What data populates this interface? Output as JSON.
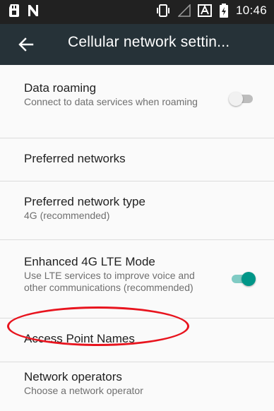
{
  "status_bar": {
    "time": "10:46",
    "icons": [
      "sd-card-icon",
      "no-signal-n-icon",
      "vibrate-icon",
      "signal-icon",
      "a-box-icon",
      "battery-icon"
    ]
  },
  "app_bar": {
    "back_icon": "arrow-back-icon",
    "title": "Cellular network settin..."
  },
  "settings": {
    "data_roaming": {
      "title": "Data roaming",
      "summary": "Connect to data services when roaming",
      "enabled": false
    },
    "preferred_networks": {
      "title": "Preferred networks"
    },
    "preferred_network_type": {
      "title": "Preferred network type",
      "summary": "4G (recommended)"
    },
    "enhanced_lte": {
      "title": "Enhanced 4G LTE Mode",
      "summary": "Use LTE services to improve voice and other communications (recommended)",
      "enabled": true
    },
    "apn": {
      "title": "Access Point Names"
    },
    "network_operators": {
      "title": "Network operators",
      "summary": "Choose a network operator"
    }
  },
  "colors": {
    "status_bar": "#212121",
    "app_bar": "#263238",
    "accent": "#009688",
    "highlight": "#e8141e"
  }
}
